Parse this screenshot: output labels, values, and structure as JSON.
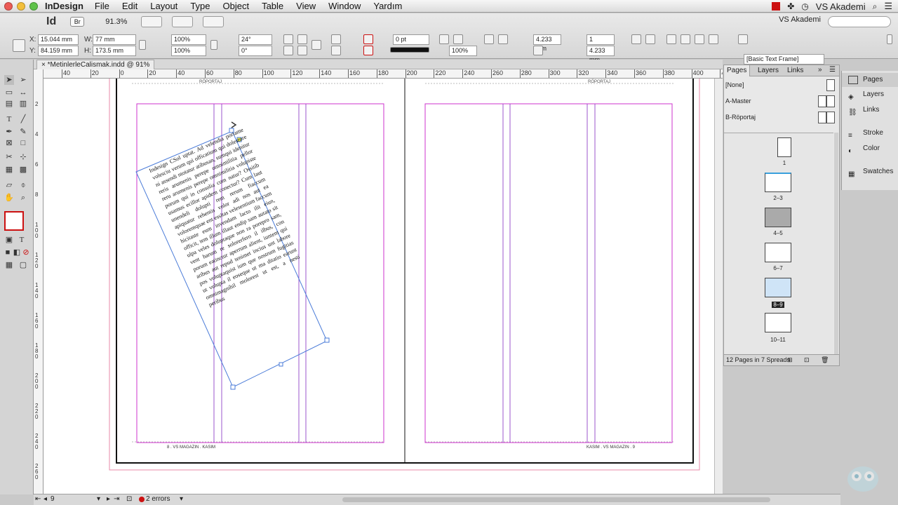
{
  "menubar": {
    "app": "InDesign",
    "items": [
      "File",
      "Edit",
      "Layout",
      "Type",
      "Object",
      "Table",
      "View",
      "Window",
      "Yardım"
    ],
    "right_label": "VS Akademi"
  },
  "control": {
    "zoom": "91.3%",
    "x": "15.044 mm",
    "y": "84.159 mm",
    "w": "77 mm",
    "h": "173.5 mm",
    "scale_x": "100%",
    "scale_y": "100%",
    "rotation": "24°",
    "shear": "0°",
    "stroke_weight": "0 pt",
    "opacity": "100%",
    "gutter": "4.233 mm",
    "columns": "1",
    "col_width": "4.233 mm",
    "workspace": "VS Akademi",
    "frame_style": "[Basic Text Frame]",
    "labels": {
      "x": "X:",
      "y": "Y:",
      "w": "W:",
      "h": "H:"
    }
  },
  "document": {
    "tab_title": "*MetinlerleCalismak.indd @ 91%",
    "running_head_left": "RÖPORTAJ",
    "running_head_right": "RÖPORTAJ",
    "footer_left": "8 . VS MAGAZIN . KASIM",
    "footer_right": "KASIM . VS MAGAZIN . 9",
    "rotated_text": "Indesign CSol uptat. Ad velendia poriame volesciu verum qui officatium qui dolesrore ni assendi ntotatur atibusan, sumqui idenitur reris arumenis perepe omnimilitia pellor reru arumenis perepe omnimilitia volupiste porum qui in consolia cum natur? Ossitib usamus ecillor apidem conectur? Cum laut unendeli dolupti rem rerum fiaccum apiquatur rehentis volor adi nos aut ea voloremquae ent essitas velesentium faccum hicitaste eum invendam lacto ilit eiun, officit, tem illum illaut endip sam autato sit ulpa veles doluptaque non ra porepro sam, vent harum re solorerfero il ilbus, con porum eatinctur aperrum alient, iuntem qui aribus aut repud tenimet incius unt labore pos voluptaquist ium que nostrum fugitias ut volupta il eoseque ut ma ditatio earunt omnimagnihil molorest ut est, a nesti peribus"
  },
  "rulers": {
    "h": [
      "40",
      "20",
      "0",
      "20",
      "40",
      "60",
      "80",
      "100",
      "120",
      "140",
      "160",
      "180",
      "200",
      "220",
      "240",
      "260",
      "280",
      "300",
      "320",
      "340",
      "360",
      "380",
      "400",
      "420"
    ],
    "v": [
      "2",
      "4",
      "6",
      "8",
      "1 0 0",
      "1 2 0",
      "1 4 0",
      "1 6 0",
      "1 8 0",
      "2 0 0",
      "2 2 0",
      "2 4 0",
      "2 6 0",
      "2 8 0"
    ]
  },
  "status": {
    "page": "9",
    "errors": "2 errors"
  },
  "pages_panel": {
    "tabs": [
      "Pages",
      "Layers",
      "Links"
    ],
    "masters": [
      "[None]",
      "A-Master",
      "B-Röportaj"
    ],
    "page_labels": [
      "1",
      "2–3",
      "4–5",
      "6–7",
      "8–9",
      "10–11"
    ],
    "footer": "12 Pages in 7 Spreads"
  },
  "side_panel": {
    "items": [
      "Pages",
      "Layers",
      "Links",
      "Stroke",
      "Color",
      "Swatches"
    ]
  },
  "colors": {
    "margin_guide": "#cc33cc",
    "selection": "#4a7bd8",
    "accent_red": "#cc1111"
  }
}
